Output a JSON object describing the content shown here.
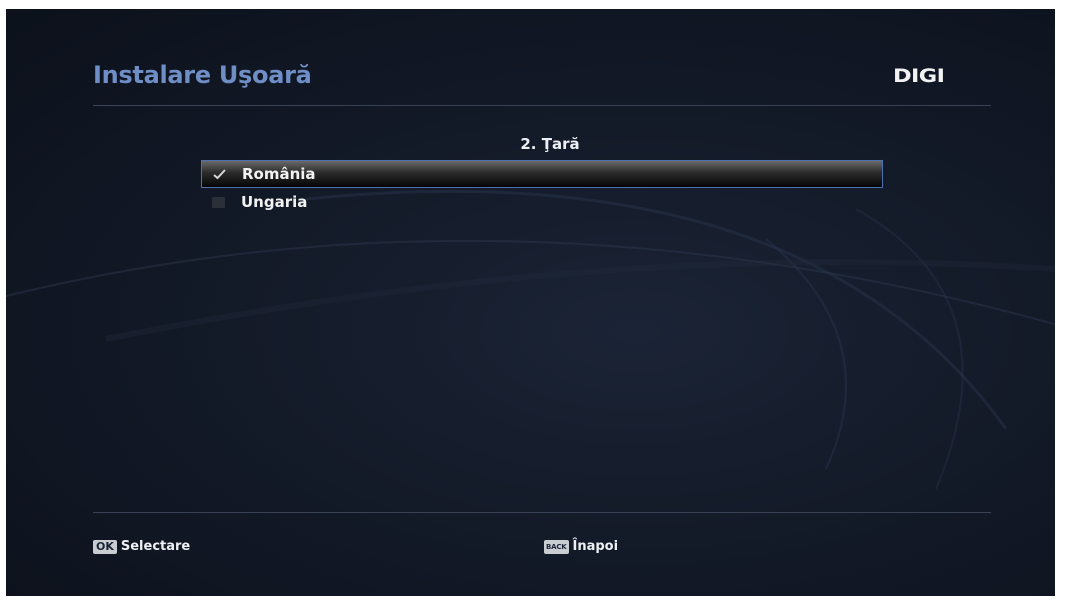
{
  "header": {
    "title": "Instalare Uşoară",
    "logo_text": "DIGI"
  },
  "step": {
    "title": "2. Ţară"
  },
  "country_list": {
    "items": [
      {
        "label": "România",
        "checked": true,
        "highlighted": true
      },
      {
        "label": "Ungaria",
        "checked": false,
        "highlighted": false
      }
    ]
  },
  "footer": {
    "ok_key": "OK",
    "ok_label": "Selectare",
    "back_key": "BACK",
    "back_label": "Înapoi"
  },
  "colors": {
    "title": "#6f8ec6",
    "background": "#131a28",
    "selection_border": "#4f6fb3"
  },
  "icons": {
    "checked": "checkmark-icon",
    "unchecked": "empty-checkbox-icon"
  }
}
